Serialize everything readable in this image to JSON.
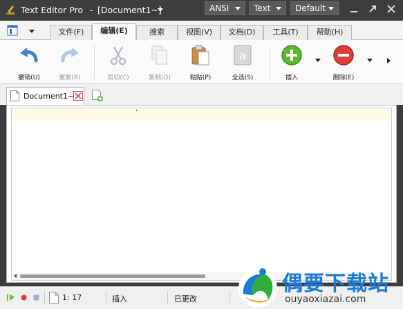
{
  "titlebar": {
    "app_name": "Text Editor Pro",
    "separator": "-",
    "document": "[Document1~]",
    "encoding": "ANSI",
    "mode": "Text",
    "theme": "Default"
  },
  "tabs": [
    {
      "label": "文件(F)"
    },
    {
      "label": "编辑(E)",
      "active": true
    },
    {
      "label": "搜索"
    },
    {
      "label": "视图(V)"
    },
    {
      "label": "文档(D)"
    },
    {
      "label": "工具(T)"
    },
    {
      "label": "帮助(H)"
    }
  ],
  "ribbon": {
    "undo": "撤销(U)",
    "redo": "重复(R)",
    "cut": "剪切(C)",
    "copy": "复制(O)",
    "paste": "粘贴(P)",
    "select_all": "全选(S)",
    "insert": "插入",
    "delete": "删除(E)"
  },
  "doc_tab": {
    "name": "Document1~"
  },
  "statusbar": {
    "position": "1: 17",
    "insert_mode": "插入",
    "modified": "已更改"
  },
  "watermark": {
    "title": "偶要下载站",
    "url": "ouyaoxiazai.com"
  },
  "colors": {
    "titlebar_bg": "#3d3d3d",
    "current_line": "#fffbe6",
    "insert_green": "#5cb82d",
    "delete_red": "#d9403a",
    "watermark_blue": "#1a7bd6"
  }
}
